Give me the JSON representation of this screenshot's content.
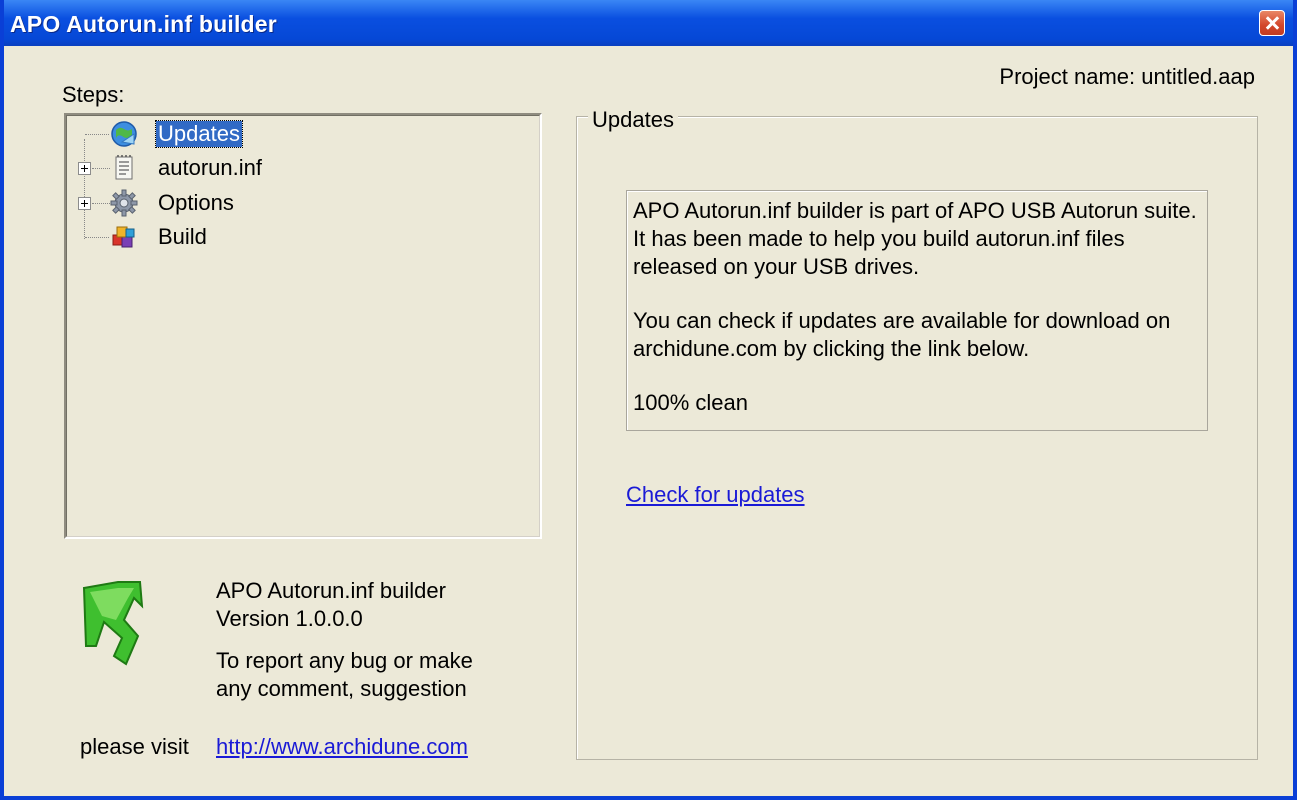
{
  "window": {
    "title": "APO Autorun.inf builder"
  },
  "steps_label": "Steps:",
  "project": {
    "label": "Project name: untitled.aap"
  },
  "tree": {
    "items": [
      {
        "label": "Updates",
        "selected": true,
        "icon": "globe-update-icon",
        "expandable": false
      },
      {
        "label": "autorun.inf",
        "selected": false,
        "icon": "document-icon",
        "expandable": true
      },
      {
        "label": "Options",
        "selected": false,
        "icon": "gear-icon",
        "expandable": true
      },
      {
        "label": "Build",
        "selected": false,
        "icon": "build-cubes-icon",
        "expandable": false
      }
    ]
  },
  "panel": {
    "title": "Updates",
    "paragraphs": [
      "APO Autorun.inf builder is part of APO USB Autorun suite. It has been made to help you build autorun.inf files released on your USB drives.",
      "You can check if updates are available for download on archidune.com by clicking the link below.",
      "100% clean"
    ],
    "check_link": "Check for updates"
  },
  "about": {
    "app_name": "APO Autorun.inf builder",
    "version": "Version 1.0.0.0",
    "report_line1": "To report any bug or make",
    "report_line2": "any comment, suggestion",
    "visit_label": "please visit",
    "url": "http://www.archidune.com"
  },
  "colors": {
    "title_bar": "#0a4fe0",
    "selection": "#316ac5",
    "link": "#1a1ad6",
    "background": "#ece9d8"
  }
}
